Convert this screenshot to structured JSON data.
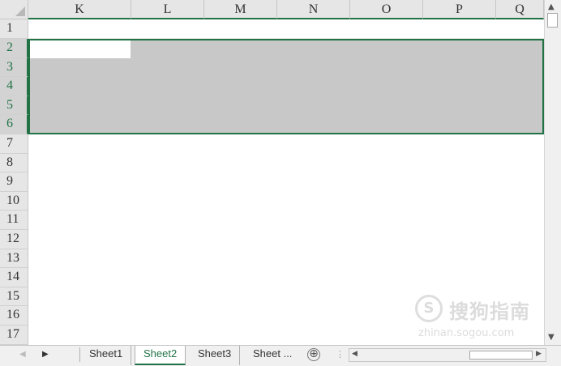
{
  "columns": [
    "K",
    "L",
    "M",
    "N",
    "O",
    "P",
    "Q"
  ],
  "rows": [
    "1",
    "2",
    "3",
    "4",
    "5",
    "6",
    "7",
    "8",
    "9",
    "10",
    "11",
    "12",
    "13",
    "14",
    "15",
    "16",
    "17"
  ],
  "tabs": [
    {
      "label": "Sheet1"
    },
    {
      "label": "Sheet2"
    },
    {
      "label": "Sheet3"
    },
    {
      "label": "Sheet ..."
    }
  ],
  "add_sheet_label": "⊕",
  "watermark": {
    "logo": "S",
    "text": "搜狗指南",
    "url": "zhinan.sogou.com"
  },
  "colors": {
    "accent": "#217346",
    "selection": "#c8c8c8",
    "header": "#e6e6e6"
  }
}
